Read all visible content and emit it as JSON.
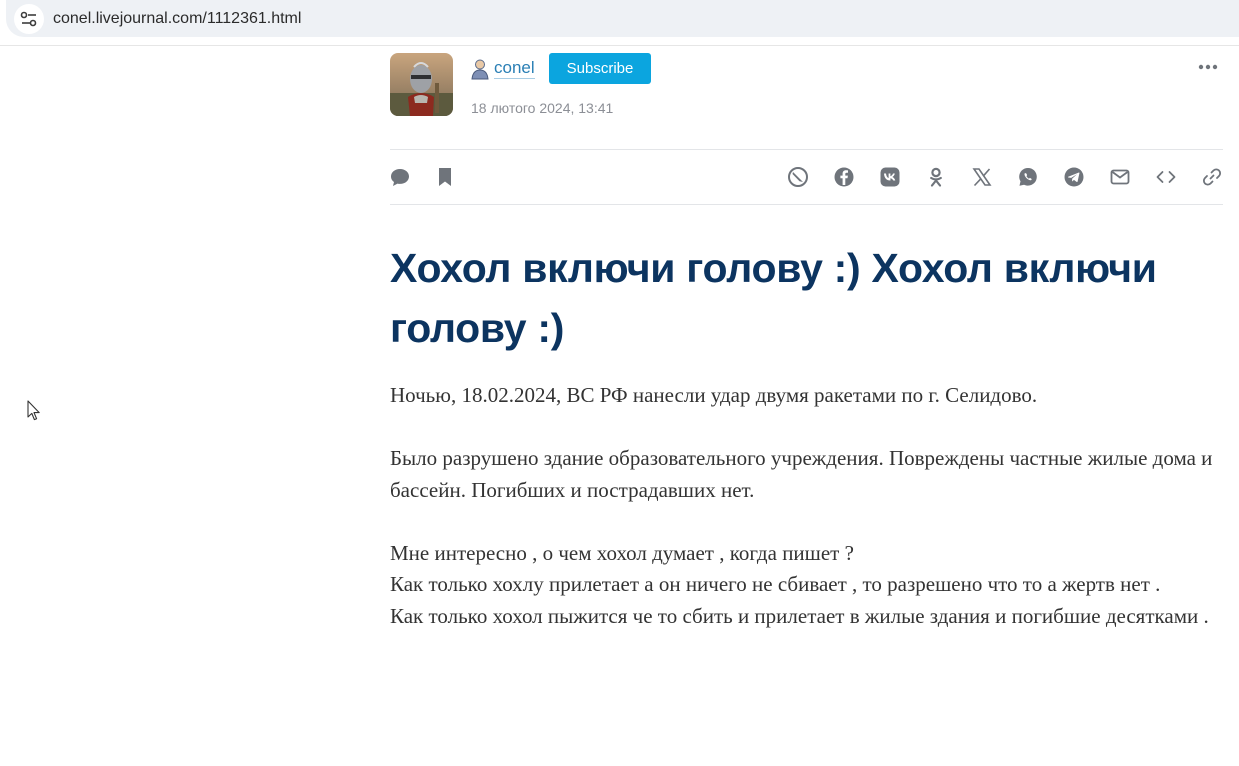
{
  "browser": {
    "url": "conel.livejournal.com/1112361.html"
  },
  "post": {
    "author": "conel",
    "subscribe_label": "Subscribe",
    "date": "18 лютого 2024, 13:41",
    "title": "Хохол включи голову :) Хохол включи голову :)",
    "paragraphs": [
      [
        "Ночью, 18.02.2024, ВС РФ нанесли удар двумя ракетами по г. Селидово."
      ],
      [
        "Было разрушено здание образовательного учреждения. Повреждены частные жилые дома и бассейн. Погибших и пострадавших нет."
      ],
      [
        "Мне интересно , о чем хохол думает , когда пишет ?",
        "Как только хохлу прилетает а он ничего не сбивает , то разрешено что то а жертв нет .",
        "Как только хохол пыжится че то сбить и прилетает в жилые здания и погибшие десятками ."
      ]
    ]
  },
  "icons": {
    "site_info": "tune-icon",
    "user": "user-icon",
    "more": "more-dots-icon",
    "left_actions": [
      "comment-icon",
      "bookmark-icon"
    ],
    "share": [
      "livejournal-share-icon",
      "facebook-icon",
      "vk-icon",
      "odnoklassniki-icon",
      "x-icon",
      "whatsapp-icon",
      "telegram-icon",
      "email-icon",
      "embed-code-icon",
      "copy-link-icon"
    ]
  },
  "colors": {
    "accent": "#0ba5df",
    "link": "#2a7fb5",
    "title": "#0c3460",
    "icon": "#6f747b"
  }
}
